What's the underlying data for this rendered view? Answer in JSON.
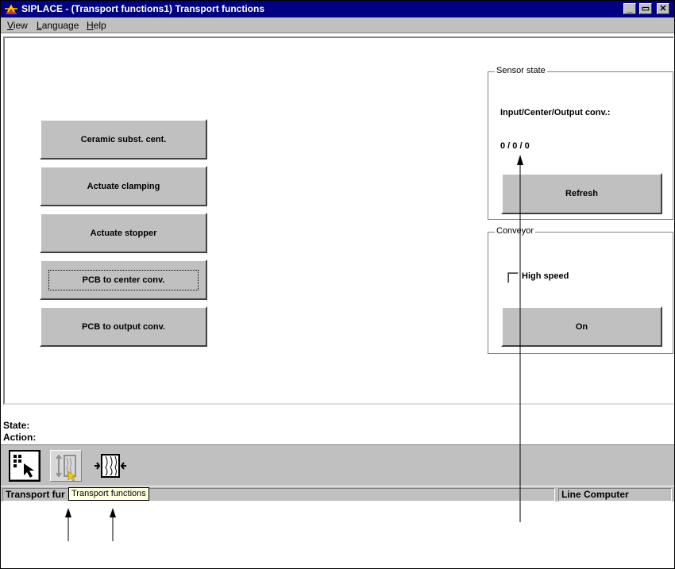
{
  "window": {
    "title": "SIPLACE - (Transport functions1) Transport functions",
    "controls": [
      "_",
      "▭",
      "✕"
    ]
  },
  "menubar": {
    "items": [
      {
        "label": "View"
      },
      {
        "label": "Language"
      },
      {
        "label": "Help"
      }
    ]
  },
  "actions": {
    "buttons": [
      {
        "label": "Ceramic subst. cent."
      },
      {
        "label": "Actuate clamping"
      },
      {
        "label": "Actuate stopper"
      },
      {
        "label": "PCB to center conv."
      },
      {
        "label": "PCB to output conv."
      }
    ]
  },
  "sensor_state": {
    "legend": "Sensor state",
    "label": "Input/Center/Output conv.:",
    "value": "0 / 0 / 0",
    "refresh_label": "Refresh"
  },
  "conveyor": {
    "legend": "Conveyor",
    "high_speed_label": "High speed",
    "high_speed_checked": false,
    "on_label": "On"
  },
  "info": {
    "state_label": "State:",
    "action_label": "Action:"
  },
  "toolbar": {
    "tooltip": "Transport functions",
    "tools": [
      {
        "icon": "selector-icon"
      },
      {
        "icon": "transport-functions-icon"
      },
      {
        "icon": "conveyor-width-icon"
      }
    ]
  },
  "statusbar": {
    "left_text": "Transport fur",
    "right_text": "Line Computer"
  },
  "colors": {
    "titlebar": "#000080",
    "face": "#c0c0c0",
    "tooltip": "#ffffe1"
  }
}
